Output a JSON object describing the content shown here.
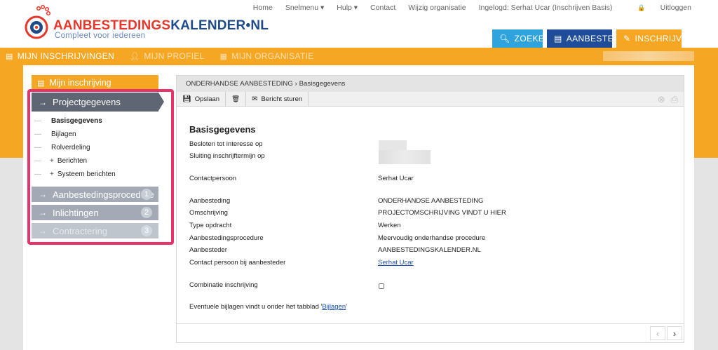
{
  "brand": {
    "name_part1": "AANBESTEDINGS",
    "name_part2": "KALENDER",
    "name_part3": "•NL",
    "tagline": "Compleet voor iedereen"
  },
  "topnav": {
    "items": [
      "Home",
      "Snelmenu ▾",
      "Hulp ▾",
      "Contact",
      "Wijzig organisatie",
      "Ingelogd: Serhat Ucar (Inschrijven Basis)"
    ],
    "logout": "Uitloggen"
  },
  "actions": {
    "zoeken": "ZOEKEN",
    "aanbesteden": "AANBESTEDEN",
    "inschrijven": "INSCHRIJVEN"
  },
  "subnav": {
    "items": [
      "MIJN INSCHRIJVINGEN",
      "MIJN PROFIEL",
      "MIJN ORGANISATIE"
    ]
  },
  "leftmenu": {
    "header": "Mijn inschrijving",
    "active": "Projectgegevens",
    "subitems": [
      "Basisgegevens",
      "Bijlagen",
      "Rolverdeling",
      "Berichten",
      "Systeem berichten"
    ],
    "sections": [
      {
        "label": "Aanbestedingsprocedure",
        "badge": "1"
      },
      {
        "label": "Inlichtingen",
        "badge": "2"
      },
      {
        "label": "Contractering",
        "badge": "3"
      }
    ]
  },
  "content": {
    "breadcrumb": "ONDERHANDSE AANBESTEDING › Basisgegevens",
    "toolbar": {
      "save": "Opslaan",
      "send": "Bericht sturen"
    },
    "title": "Basisgegevens",
    "fields": {
      "besloten": "Besloten tot interesse op",
      "sluiting": "Sluiting inschrijftermijn op",
      "contactpersoon_label": "Contactpersoon",
      "contactpersoon_value": "Serhat Ucar",
      "aanbesteding_label": "Aanbesteding",
      "aanbesteding_value": "ONDERHANDSE AANBESTEDING",
      "omschrijving_label": "Omschrijving",
      "omschrijving_value": "PROJECTOMSCHRIJVING VINDT U HIER",
      "type_label": "Type opdracht",
      "type_value": "Werken",
      "procedure_label": "Aanbestedingsprocedure",
      "procedure_value": "Meervoudig onderhandse procedure",
      "aanbesteder_label": "Aanbesteder",
      "aanbesteder_value": "AANBESTEDINGSKALENDER.NL",
      "contact_aanb_label": "Contact persoon bij aanbesteder",
      "contact_aanb_value": "Serhat Ucar",
      "combinatie_label": "Combinatie inschrijving",
      "bijlagen_text": "Eventuele bijlagen vindt u onder het tabblad '",
      "bijlagen_link": "Bijlagen",
      "bijlagen_end": "'"
    }
  },
  "colors": {
    "orange": "#f5a623",
    "blue": "#1f4d99",
    "cyan": "#2ea3dc",
    "highlight": "#e8336b"
  }
}
